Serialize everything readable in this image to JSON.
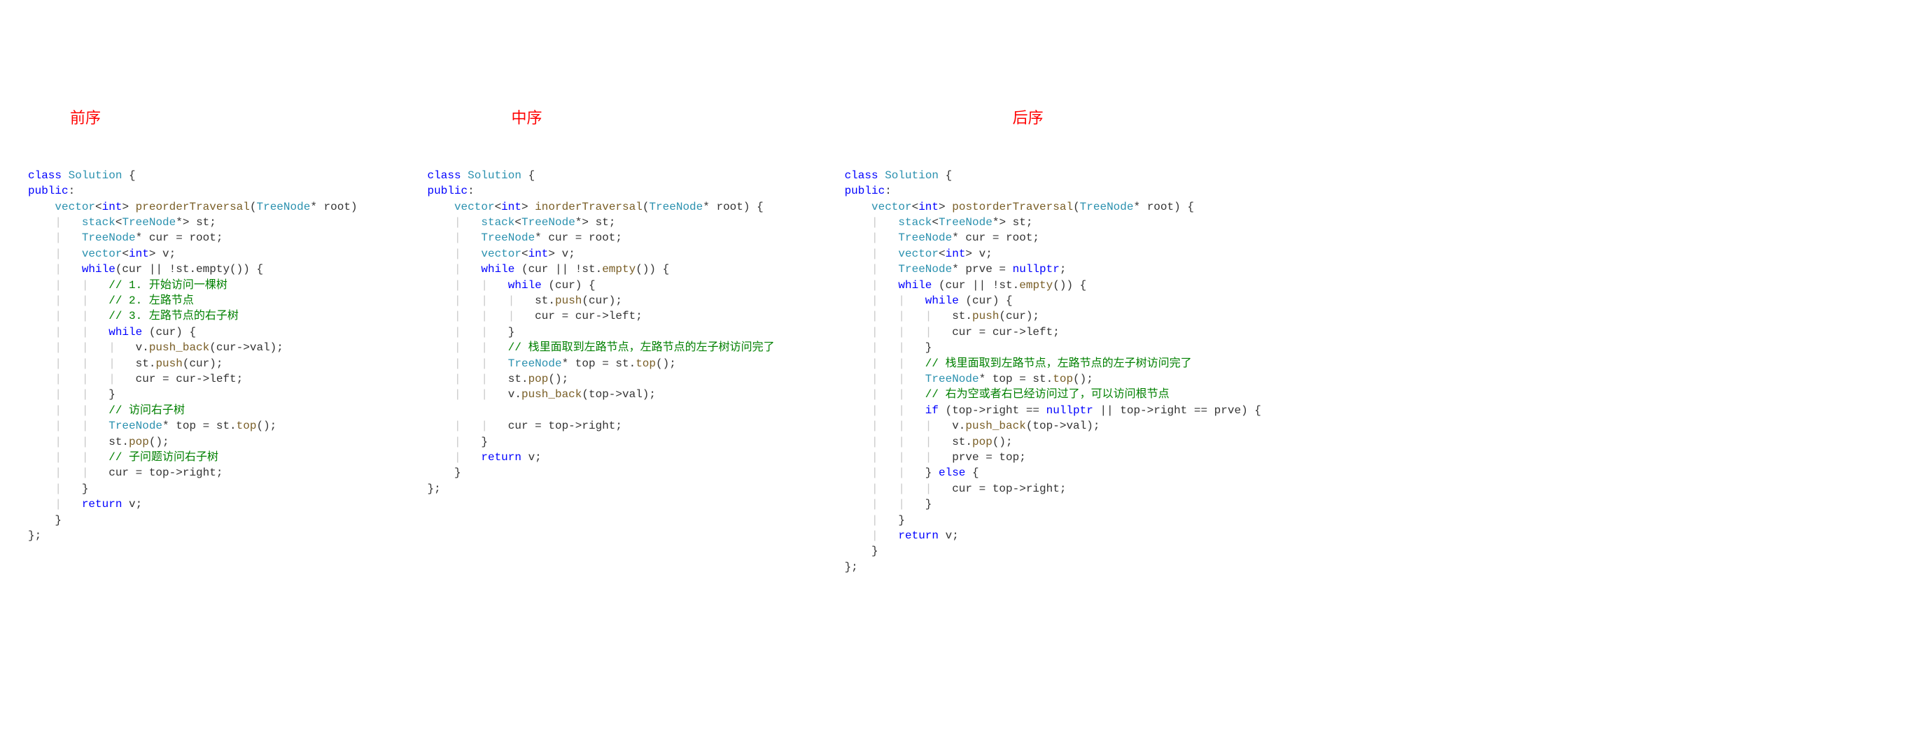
{
  "titles": {
    "pre": "前序",
    "in": "中序",
    "post": "后序"
  },
  "common": {
    "kw_class": "class",
    "cls": "Solution",
    "open": "{",
    "close": "}",
    "close_semi": "};",
    "kw_public": "public",
    "colon": ":",
    "type_vector": "vector",
    "lt": "<",
    "gt": ">",
    "type_int": "int",
    "type_TreeNode": "TreeNode",
    "star": "*",
    "amp_root": " root",
    "paren_open": "(",
    "paren_close": ")",
    "paren_close_brace": ") {",
    "type_stack": "stack",
    "var_st": " st;",
    "var_cur_decl": " cur = root;",
    "var_v_decl": " v;",
    "type_nullptr": "nullptr",
    "kw_while": "while",
    "cond_outer_open": " (cur || !st.",
    "fn_empty": "empty",
    "cond_outer_close": "()) {",
    "cond_inner": " (cur) {",
    "fn_push": "push",
    "push_cur": "(cur);",
    "assign_left": "cur = cur->left;",
    "assign_right": "cur = top->right;",
    "decl_top": " top = st.",
    "fn_top": "top",
    "call_top_close": "();",
    "fn_pop": "pop",
    "call_pop": "st.",
    "call_pop_close": "();",
    "fn_push_back": "push_back",
    "push_back_cur_val": "(cur->val);",
    "push_back_top_val": "(top->val);",
    "kw_return": "return",
    "ret_v": " v;",
    "kw_if": "if",
    "kw_else": "else",
    "v_dot": "v."
  },
  "pre": {
    "fn_name": "preorderTraversal",
    "cond_outer_full": "(cur || !st.empty()) {",
    "c1": "// 1. 开始访问一棵树",
    "c2": "// 2. 左路节点",
    "c3": "// 3. 左路节点的右子树",
    "c_visit_right": "// 访问右子树",
    "c_sub_right": "// 子问题访问右子树"
  },
  "in": {
    "fn_name": "inorderTraversal",
    "c_stack": "// 栈里面取到左路节点，左路节点的左子树访问完了"
  },
  "post": {
    "fn_name": "postorderTraversal",
    "prve_decl": " prve = ",
    "prve_decl_close": ";",
    "c_stack": "// 栈里面取到左路节点，左路节点的左子树访问完了",
    "c_right": "// 右为空或者右已经访问过了，可以访问根节点",
    "cond_if_open": " (top->right == ",
    "cond_if_mid": " || top->right == prve) {",
    "prve_assign": "prve = top;"
  }
}
